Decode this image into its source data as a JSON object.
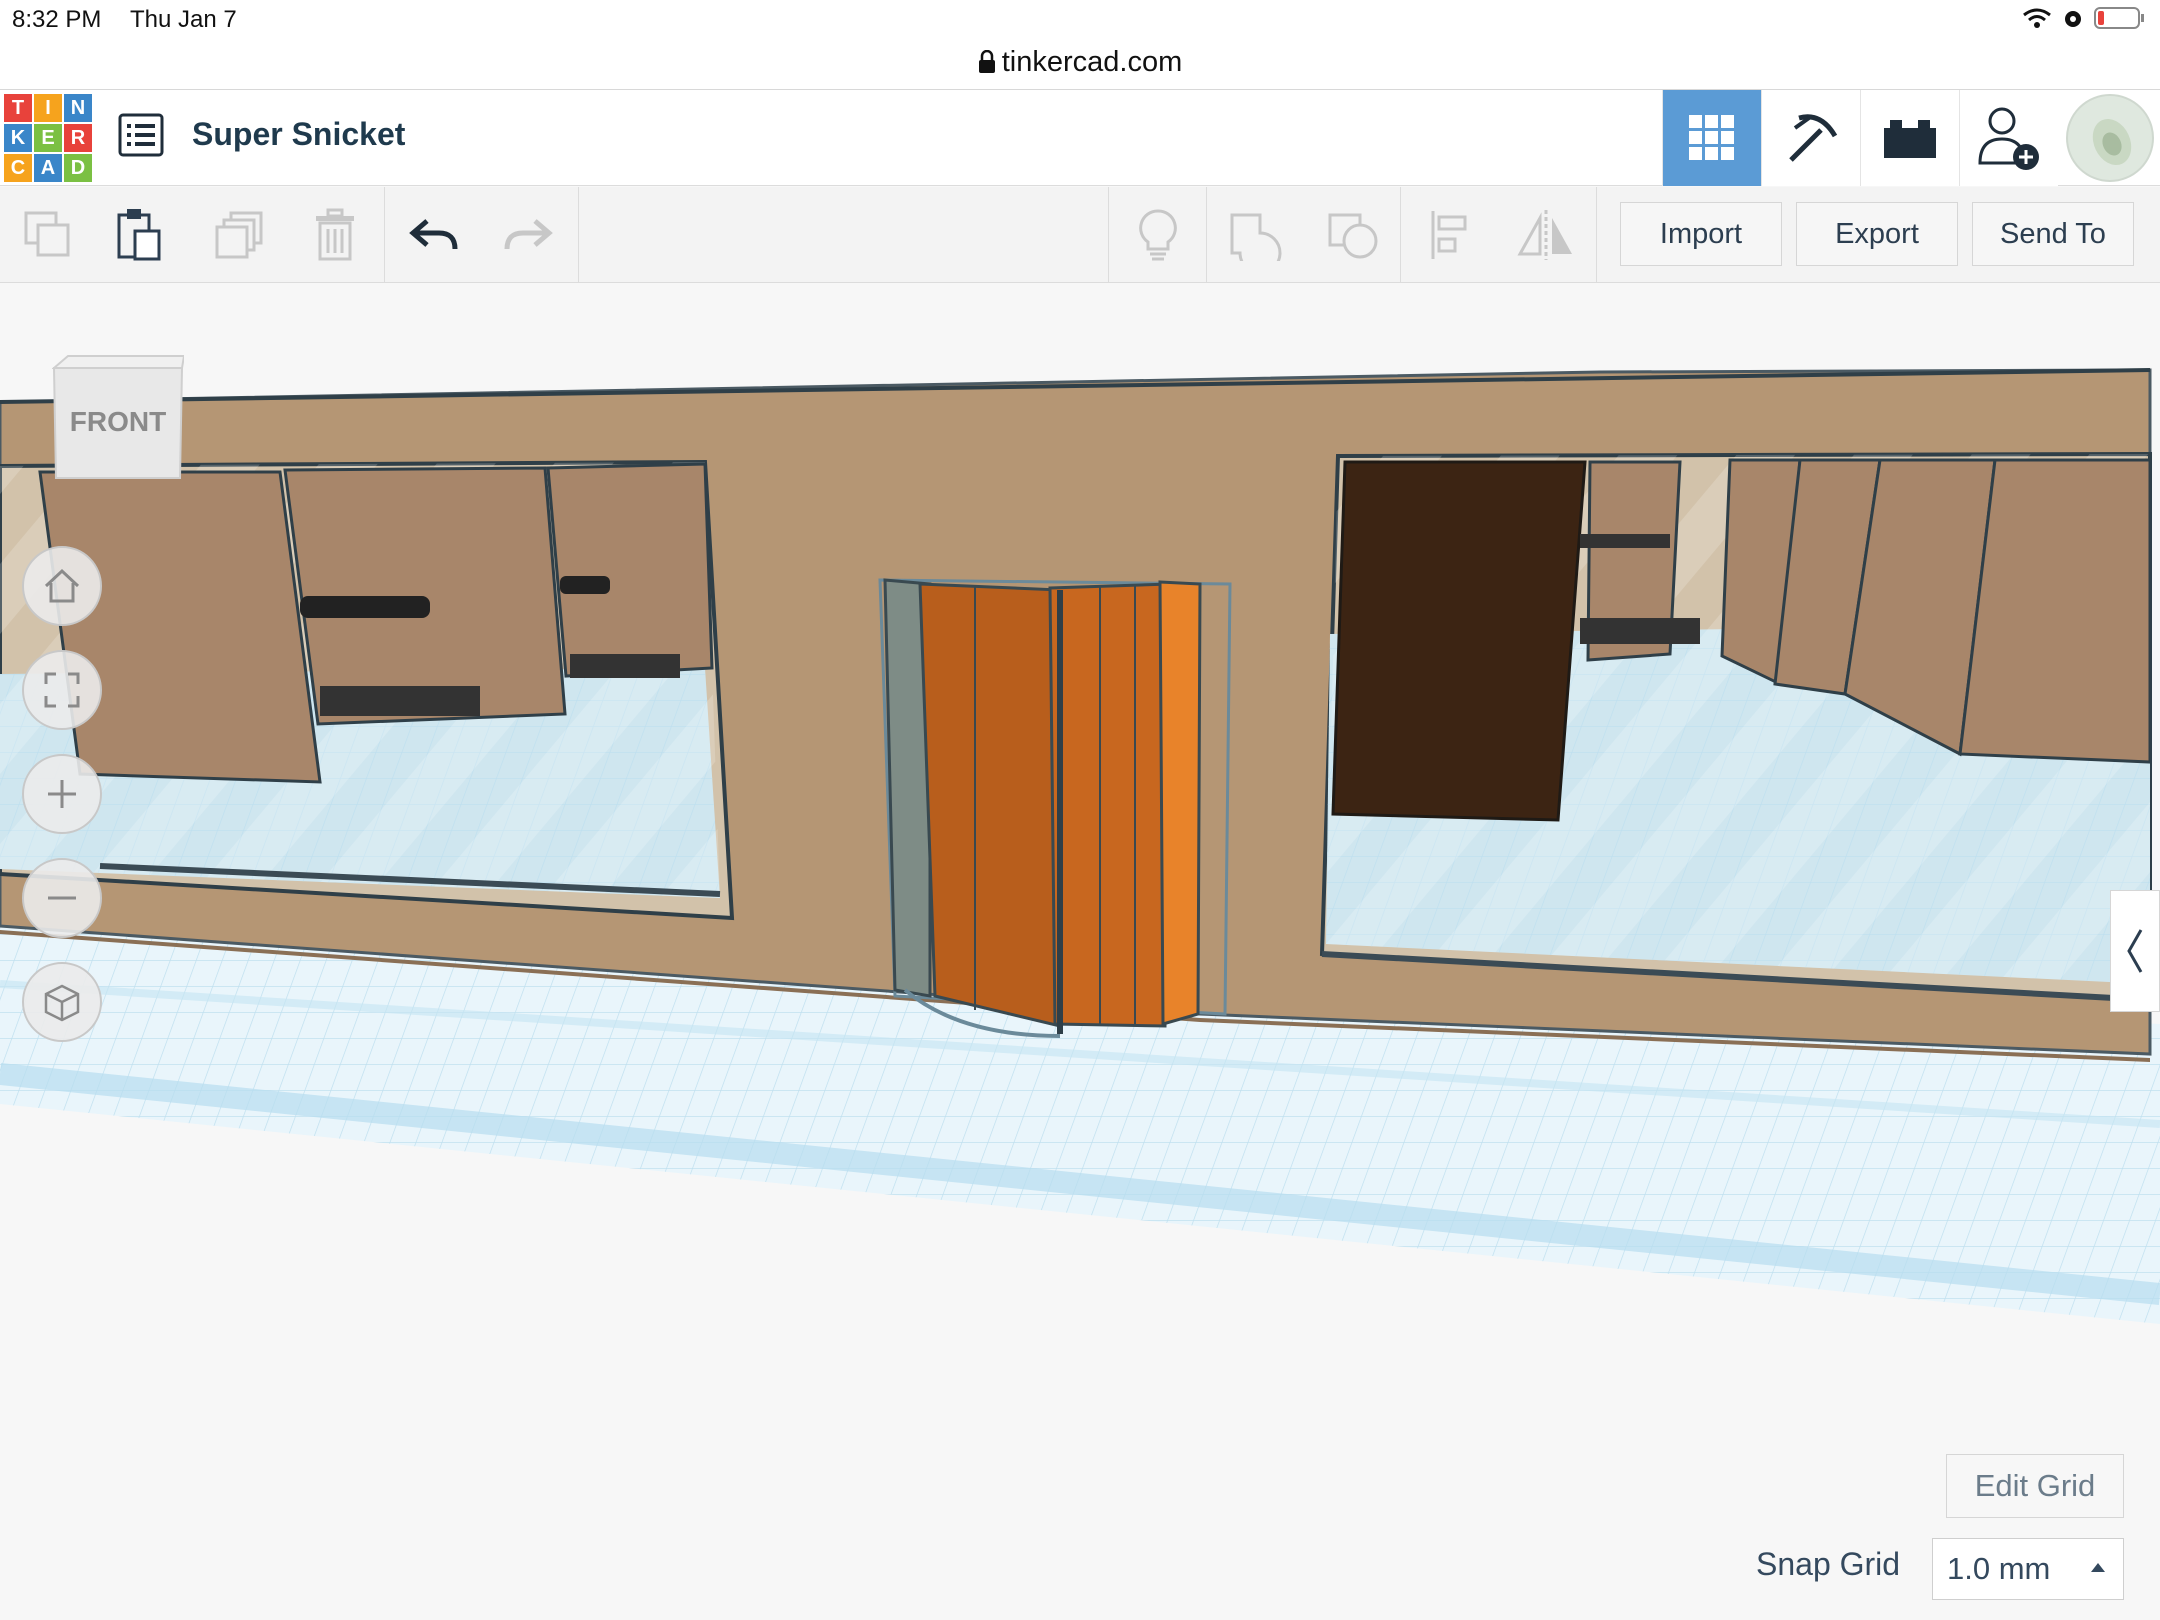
{
  "status_bar": {
    "time": "8:32 PM",
    "date": "Thu Jan 7"
  },
  "browser": {
    "url": "tinkercad.com"
  },
  "logo_letters": [
    "T",
    "I",
    "N",
    "K",
    "E",
    "R",
    "C",
    "A",
    "D"
  ],
  "logo_colors": [
    "#e8423b",
    "#f6a31d",
    "#3a86c9",
    "#3a86c9",
    "#7bc043",
    "#e8423b",
    "#f6a31d",
    "#3a86c9",
    "#7bc043"
  ],
  "header": {
    "design_title": "Super Snicket",
    "nav": [
      "3D Design",
      "Codeblocks",
      "Bricks",
      "Invite"
    ]
  },
  "toolbar": {
    "import_label": "Import",
    "export_label": "Export",
    "send_to_label": "Send To"
  },
  "viewcube": {
    "face_label": "FRONT"
  },
  "grid_controls": {
    "edit_grid_label": "Edit Grid",
    "snap_grid_label": "Snap Grid",
    "snap_grid_value": "1.0 mm"
  },
  "colors": {
    "accent": "#5b9bd5",
    "wall": "#b59674",
    "door": "#c0621a",
    "grid": "#cfe8f3"
  }
}
